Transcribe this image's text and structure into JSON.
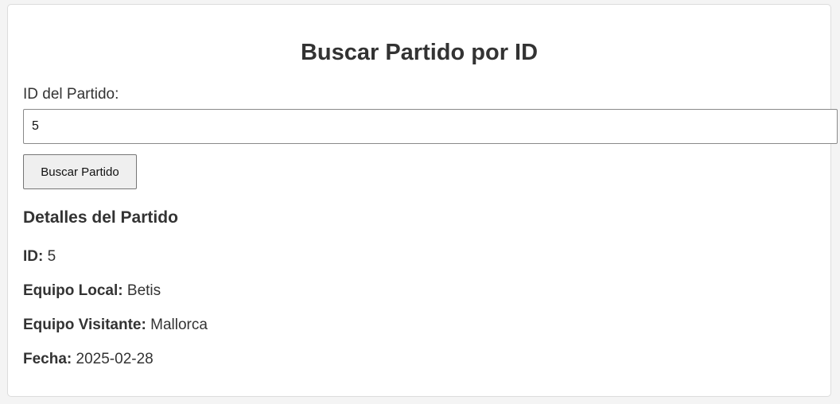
{
  "page": {
    "title": "Buscar Partido por ID"
  },
  "form": {
    "label": "ID del Partido:",
    "input_value": "5",
    "button_label": "Buscar Partido"
  },
  "details": {
    "heading": "Detalles del Partido",
    "rows": [
      {
        "label": "ID:",
        "value": "5"
      },
      {
        "label": "Equipo Local:",
        "value": "Betis"
      },
      {
        "label": "Equipo Visitante:",
        "value": "Mallorca"
      },
      {
        "label": "Fecha:",
        "value": "2025-02-28"
      }
    ]
  }
}
